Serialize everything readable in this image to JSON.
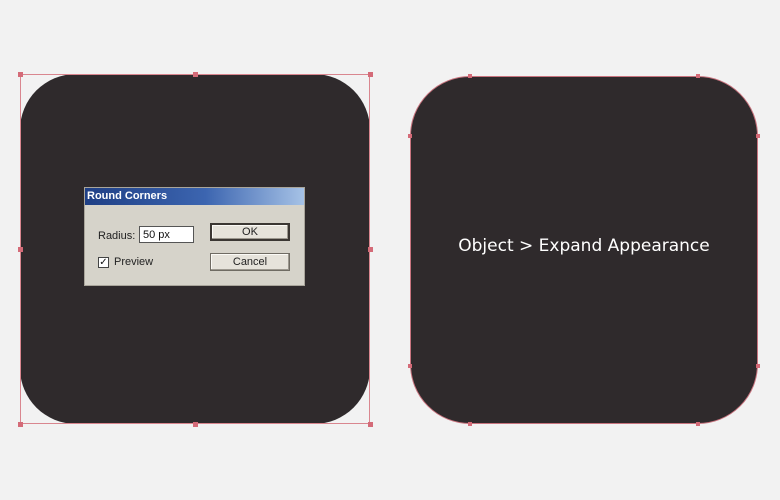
{
  "dialog": {
    "title": "Round Corners",
    "radius_label": "Radius:",
    "radius_value": "50 px",
    "preview_label": "Preview",
    "preview_checked": true,
    "ok_label": "OK",
    "cancel_label": "Cancel"
  },
  "caption": "Object > Expand Appearance",
  "colors": {
    "shape_fill": "#2f2a2c",
    "selection": "#d46b78",
    "background": "#f2f2f2"
  }
}
